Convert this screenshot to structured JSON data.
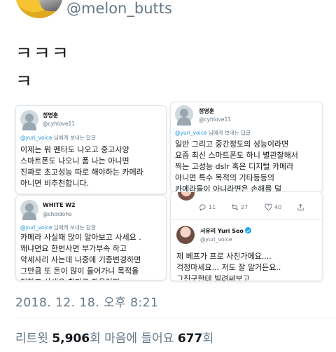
{
  "header": {
    "handle": "@melon_butts"
  },
  "tweet": {
    "line1": "ㅋㅋㅋ",
    "line2": "ㅋ"
  },
  "cards": {
    "a": {
      "name": "정명훈",
      "handle": "@cyhlove11",
      "reply_to": "@yuri_voice",
      "reply_suffix": " 님에게 보내는 답글",
      "body": "이제는 뭐 펜타도 나오고 중고사양\n스마트폰도 나오니 폼 나는 아니면\n진짜로 초고성능 따로 해야하는 카메라\n아니면 비추천합니다."
    },
    "b": {
      "name": "정명훈",
      "handle": "@cyhlove11",
      "reply_to": "@yuri_voice",
      "reply_suffix": " 님에게 보내는 답글",
      "body": "일반 그리고 중간정도의 성능이라면\n요즘 최신 스마트폰도 하니 별관찰해서\n찍는 고성능 dslr 혹은 디지털 카메라\n아니면 특수 목적의 기타등등의\n카메라들이 아니라면은 손해를 덜"
    },
    "c": {
      "name": "WHITE W2",
      "handle": "@choidoho",
      "reply_to": "@yuri_voice",
      "reply_suffix": " 님에게 보내는 답글",
      "body": "카메라 사실때 많이 알아보고 사세요 .\n왜냐면요 한번사면 부가부속 하고\n악세사리 사는데 나중에 기종변경하면\n그만큼 또 돈이 많이 들어가니 목적을\n정하고 사세요 취미로 하우려면 ..."
    },
    "d": {
      "stats": {
        "replies": "11",
        "retweets": "27",
        "likes": "40"
      },
      "name": "서유리 Yuri Seo",
      "handle": "@yuri_voice",
      "body": "제 베프가 프로 사진가에요....\n걱정마세요... 저도 잘 알거든요..\n그친구한테 빌려써보고"
    }
  },
  "footer": {
    "timestamp": "2018. 12. 18. 오후 8:21",
    "retweets_label": "리트윗",
    "retweets_count": "5,906",
    "retweets_unit": "회",
    "likes_label": "마음에 들어요",
    "likes_count": "677",
    "likes_unit": "회"
  },
  "colors": {
    "link": "#1b95e0",
    "muted": "#657786",
    "verified": "#1da1f2"
  }
}
